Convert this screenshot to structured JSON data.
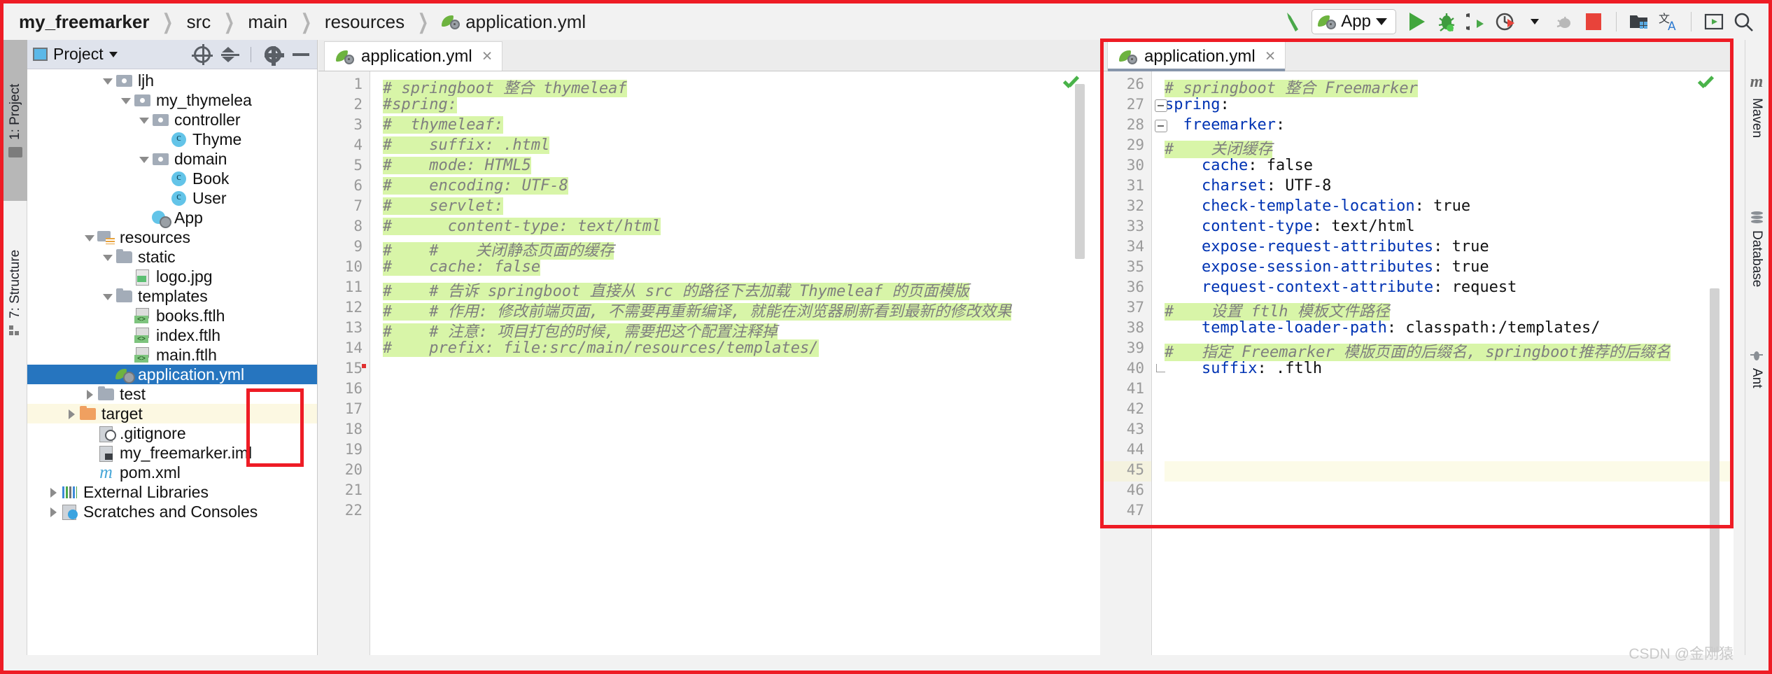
{
  "window": {
    "breadcrumb": [
      "my_freemarker",
      "src",
      "main",
      "resources",
      "application.yml"
    ],
    "watermark": "CSDN @金刚猿"
  },
  "toolbar": {
    "build_label": "build-hammer-icon",
    "run_config": "App",
    "items": [
      {
        "name": "build-hammer-icon",
        "label": ""
      },
      {
        "name": "run-button",
        "label": ""
      },
      {
        "name": "debug-button",
        "label": ""
      },
      {
        "name": "run-with-coverage-button",
        "label": ""
      },
      {
        "name": "profiler-button",
        "label": ""
      },
      {
        "name": "attach-debugger-button",
        "label": ""
      },
      {
        "name": "stop-button",
        "label": ""
      },
      {
        "name": "project-structure-button",
        "label": ""
      },
      {
        "name": "translate-button",
        "label": ""
      },
      {
        "name": "terminal-button",
        "label": ""
      },
      {
        "name": "search-everywhere-button",
        "label": ""
      }
    ]
  },
  "left_rail": {
    "project_tab": "1: Project",
    "structure_tab": "7: Structure"
  },
  "right_rail": {
    "maven_tab": "Maven",
    "database_tab": "Database",
    "ant_tab": "Ant"
  },
  "project_panel": {
    "title": "Project",
    "tree": [
      {
        "label": "ljh",
        "indent": 4,
        "arrow": "down",
        "icon": "pkg",
        "state": "normal"
      },
      {
        "label": "my_thymelea",
        "indent": 5,
        "arrow": "down",
        "icon": "pkg",
        "state": "normal"
      },
      {
        "label": "controller",
        "indent": 6,
        "arrow": "down",
        "icon": "pkg",
        "state": "normal"
      },
      {
        "label": "Thyme",
        "indent": 7,
        "arrow": "none",
        "icon": "cls",
        "state": "normal"
      },
      {
        "label": "domain",
        "indent": 6,
        "arrow": "down",
        "icon": "pkg",
        "state": "normal"
      },
      {
        "label": "Book",
        "indent": 7,
        "arrow": "none",
        "icon": "cls",
        "state": "normal"
      },
      {
        "label": "User",
        "indent": 7,
        "arrow": "none",
        "icon": "cls",
        "state": "normal"
      },
      {
        "label": "App",
        "indent": 6,
        "arrow": "none",
        "icon": "app",
        "state": "normal"
      },
      {
        "label": "resources",
        "indent": 3,
        "arrow": "down",
        "icon": "res",
        "state": "normal"
      },
      {
        "label": "static",
        "indent": 4,
        "arrow": "down",
        "icon": "fold",
        "state": "normal"
      },
      {
        "label": "logo.jpg",
        "indent": 5,
        "arrow": "none",
        "icon": "img",
        "state": "normal"
      },
      {
        "label": "templates",
        "indent": 4,
        "arrow": "down",
        "icon": "fold",
        "state": "normal"
      },
      {
        "label": "books.ftlh",
        "indent": 5,
        "arrow": "none",
        "icon": "ftl",
        "state": "normal"
      },
      {
        "label": "index.ftlh",
        "indent": 5,
        "arrow": "none",
        "icon": "ftl",
        "state": "normal"
      },
      {
        "label": "main.ftlh",
        "indent": 5,
        "arrow": "none",
        "icon": "ftl",
        "state": "normal"
      },
      {
        "label": "application.yml",
        "indent": 4,
        "arrow": "none",
        "icon": "yml",
        "state": "selected"
      },
      {
        "label": "test",
        "indent": 3,
        "arrow": "right",
        "icon": "fold",
        "state": "normal"
      },
      {
        "label": "target",
        "indent": 2,
        "arrow": "right",
        "icon": "tgt",
        "state": "warn"
      },
      {
        "label": ".gitignore",
        "indent": 3,
        "arrow": "none",
        "icon": "git",
        "state": "normal"
      },
      {
        "label": "my_freemarker.iml",
        "indent": 3,
        "arrow": "none",
        "icon": "iml",
        "state": "normal"
      },
      {
        "label": "pom.xml",
        "indent": 3,
        "arrow": "none",
        "icon": "mvn",
        "state": "normal"
      },
      {
        "label": "External Libraries",
        "indent": 1,
        "arrow": "right",
        "icon": "lib",
        "state": "normal"
      },
      {
        "label": "Scratches and Consoles",
        "indent": 1,
        "arrow": "right",
        "icon": "scr",
        "state": "normal"
      }
    ]
  },
  "editor_left": {
    "tab_label": "application.yml",
    "close_label": "×",
    "first_line": 1,
    "lines": [
      {
        "n": 1,
        "text": "# springboot 整合 thymeleaf",
        "cls": "cmt",
        "hl": true
      },
      {
        "n": 2,
        "text": "#spring:",
        "cls": "cmt",
        "hl": true
      },
      {
        "n": 3,
        "text": "#  thymeleaf:",
        "cls": "cmt",
        "hl": true
      },
      {
        "n": 4,
        "text": "#    suffix: .html",
        "cls": "cmt",
        "hl": true
      },
      {
        "n": 5,
        "text": "#    mode: HTML5",
        "cls": "cmt",
        "hl": true
      },
      {
        "n": 6,
        "text": "#    encoding: UTF-8",
        "cls": "cmt",
        "hl": true
      },
      {
        "n": 7,
        "text": "#    servlet:",
        "cls": "cmt",
        "hl": true
      },
      {
        "n": 8,
        "text": "#      content-type: text/html",
        "cls": "cmt",
        "hl": true
      },
      {
        "n": 9,
        "text": "#    #    关闭静态页面的缓存",
        "cls": "cmt",
        "hl": true
      },
      {
        "n": 10,
        "text": "#    cache: false",
        "cls": "cmt",
        "hl": true
      },
      {
        "n": 11,
        "text": "#    # 告诉 springboot 直接从 src 的路径下去加载 Thymeleaf 的页面模版",
        "cls": "cmt",
        "hl": true
      },
      {
        "n": 12,
        "text": "#    # 作用: 修改前端页面, 不需要再重新编译, 就能在浏览器刷新看到最新的修改效果",
        "cls": "cmt",
        "hl": true
      },
      {
        "n": 13,
        "text": "#    # 注意: 项目打包的时候, 需要把这个配置注释掉",
        "cls": "cmt",
        "hl": true
      },
      {
        "n": 14,
        "text": "#    prefix: file:src/main/resources/templates/",
        "cls": "cmt",
        "hl": true
      },
      {
        "n": 15,
        "text": "",
        "cls": "val",
        "hl": false
      },
      {
        "n": 16,
        "text": "",
        "cls": "val",
        "hl": false
      },
      {
        "n": 17,
        "text": "",
        "cls": "val",
        "hl": false
      },
      {
        "n": 18,
        "text": "",
        "cls": "val",
        "hl": false
      },
      {
        "n": 19,
        "text": "",
        "cls": "val",
        "hl": false
      },
      {
        "n": 20,
        "text": "",
        "cls": "val",
        "hl": false
      },
      {
        "n": 21,
        "text": "",
        "cls": "val",
        "hl": false
      },
      {
        "n": 22,
        "text": "",
        "cls": "val",
        "hl": false
      }
    ]
  },
  "editor_right": {
    "tab_label": "application.yml",
    "close_label": "×",
    "lines": [
      {
        "n": 26,
        "kind": "comment",
        "text": "# springboot 整合 Freemarker",
        "hl": true
      },
      {
        "n": 27,
        "kind": "pair",
        "key": "spring",
        "sep": ":",
        "value": "",
        "indent": 0,
        "fold": "start"
      },
      {
        "n": 28,
        "kind": "pair",
        "key": "  freemarker",
        "sep": ":",
        "value": "",
        "indent": 0,
        "fold": "start"
      },
      {
        "n": 29,
        "kind": "comment",
        "text": "#    关闭缓存",
        "hl": true
      },
      {
        "n": 30,
        "kind": "pair",
        "key": "    cache",
        "sep": ": ",
        "value": "false"
      },
      {
        "n": 31,
        "kind": "pair",
        "key": "    charset",
        "sep": ": ",
        "value": "UTF-8"
      },
      {
        "n": 32,
        "kind": "pair",
        "key": "    check-template-location",
        "sep": ": ",
        "value": "true"
      },
      {
        "n": 33,
        "kind": "pair",
        "key": "    content-type",
        "sep": ": ",
        "value": "text/html"
      },
      {
        "n": 34,
        "kind": "pair",
        "key": "    expose-request-attributes",
        "sep": ": ",
        "value": "true"
      },
      {
        "n": 35,
        "kind": "pair",
        "key": "    expose-session-attributes",
        "sep": ": ",
        "value": "true"
      },
      {
        "n": 36,
        "kind": "pair",
        "key": "    request-context-attribute",
        "sep": ": ",
        "value": "request"
      },
      {
        "n": 37,
        "kind": "comment",
        "text": "#    设置 ftlh 模板文件路径",
        "hl": true
      },
      {
        "n": 38,
        "kind": "pair",
        "key": "    template-loader-path",
        "sep": ": ",
        "value": "classpath:/templates/"
      },
      {
        "n": 39,
        "kind": "comment",
        "text": "#   指定 Freemarker 模版页面的后缀名, springboot推荐的后缀名",
        "hl": true
      },
      {
        "n": 40,
        "kind": "pair",
        "key": "    suffix",
        "sep": ": ",
        "value": ".ftlh",
        "fold": "end"
      },
      {
        "n": 41,
        "kind": "blank",
        "text": ""
      },
      {
        "n": 42,
        "kind": "blank",
        "text": ""
      },
      {
        "n": 43,
        "kind": "blank",
        "text": ""
      },
      {
        "n": 44,
        "kind": "blank",
        "text": ""
      },
      {
        "n": 45,
        "kind": "blank",
        "text": "",
        "current": true
      },
      {
        "n": 46,
        "kind": "blank",
        "text": ""
      },
      {
        "n": 47,
        "kind": "blank",
        "text": ""
      }
    ]
  }
}
